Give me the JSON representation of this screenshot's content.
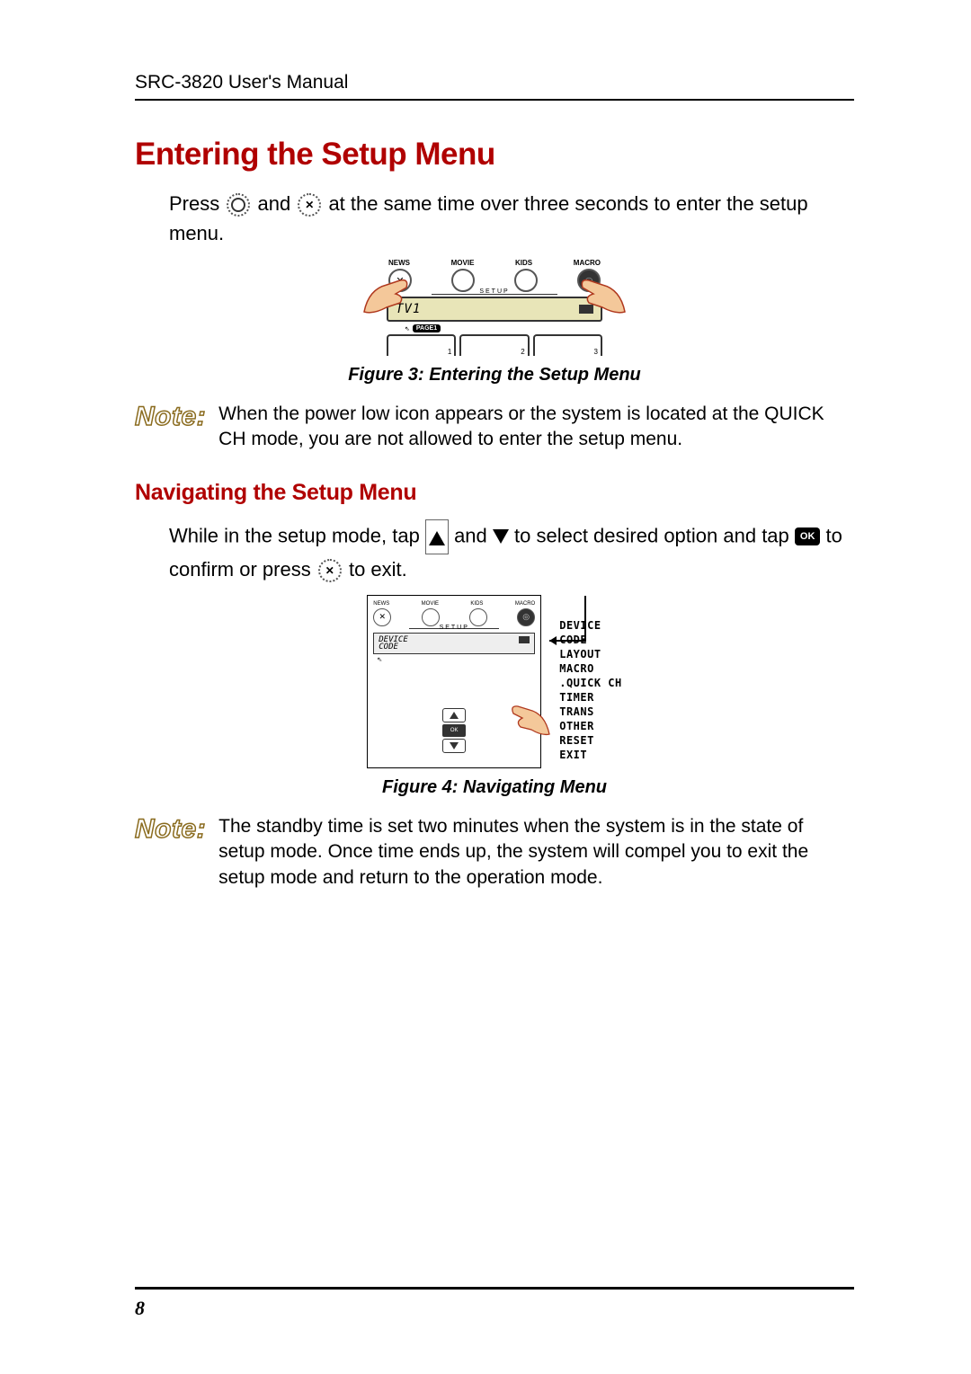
{
  "header": "SRC-3820 User's Manual",
  "section1": {
    "title": "Entering the Setup Menu",
    "para_a": "Press ",
    "para_b": " and ",
    "para_c": " at the same time over three seconds to enter the setup menu."
  },
  "figure3": {
    "labels": [
      "NEWS",
      "MOVIE",
      "KIDS",
      "MACRO"
    ],
    "setup_text": "SETUP",
    "screen_text": "TV1",
    "page_badge": "PAGE1",
    "softkeys": [
      "1",
      "2",
      "3"
    ],
    "caption": "Figure 3: Entering the Setup Menu"
  },
  "note1": {
    "label": "Note:",
    "text": "When the power low icon appears or the system is located at the QUICK CH mode, you are not allowed to enter the setup menu."
  },
  "section2": {
    "title": "Navigating the Setup Menu",
    "para_a": "While in the setup mode, tap ",
    "para_b": " and ",
    "para_c": " to select desired option and tap ",
    "para_d": " to confirm or press ",
    "para_e": " to exit."
  },
  "figure4": {
    "labels": [
      "NEWS",
      "MOVIE",
      "KIDS",
      "MACRO"
    ],
    "setup_text": "SETUP",
    "screen_line1": "DEVICE",
    "screen_line2": "CODE",
    "ok_label": "OK",
    "menu_items": [
      "DEVICE",
      "CODE",
      "LAYOUT",
      "MACRO",
      ".QUICK CH",
      "TIMER",
      "TRANS",
      "OTHER",
      "RESET",
      "EXIT"
    ],
    "caption": "Figure 4: Navigating Menu"
  },
  "note2": {
    "label": "Note:",
    "text": "The standby time is set two minutes when the system is in the state of setup mode.  Once time ends up, the system will compel you to exit the setup mode and return to the operation mode."
  },
  "inline_ok": "OK",
  "page_number": "8"
}
